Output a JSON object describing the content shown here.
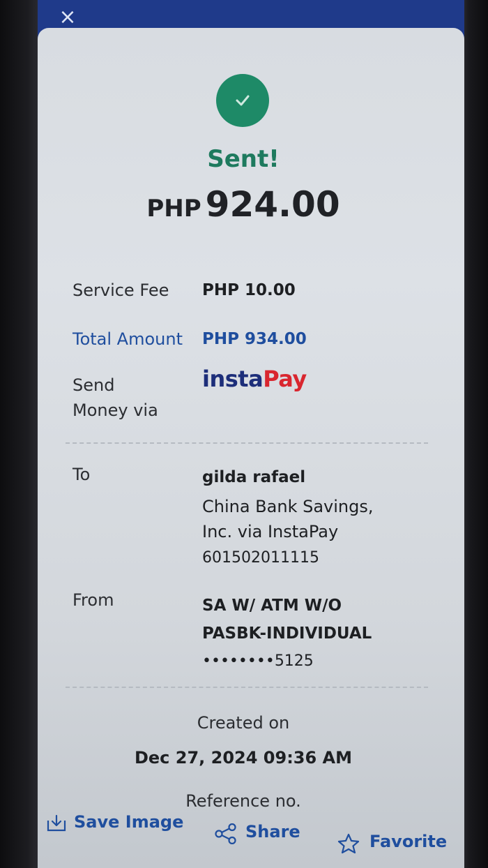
{
  "header": {
    "close_label": "×"
  },
  "status": {
    "title": "Sent!",
    "currency": "PHP",
    "amount": "924.00"
  },
  "details": {
    "service_fee_label": "Service Fee",
    "service_fee_value": "PHP 10.00",
    "total_label": "Total Amount",
    "total_value": "PHP 934.00",
    "via_label_line1": "Send",
    "via_label_line2": "Money via",
    "via_logo_part1": "insta",
    "via_logo_part2": "Pay",
    "to_label": "To",
    "to_name": "gilda rafael",
    "to_bank_line1": "China Bank Savings,",
    "to_bank_line2": "Inc. via InstaPay",
    "to_account": "601502011115",
    "from_label": "From",
    "from_account_type_line1": "SA W/ ATM W/O",
    "from_account_type_line2": "PASBK-INDIVIDUAL",
    "from_account_masked": "••••••••5125"
  },
  "meta": {
    "created_label": "Created on",
    "created_value": "Dec 27, 2024 09:36 AM",
    "reference_label": "Reference no."
  },
  "actions": {
    "save_label": "Save Image",
    "share_label": "Share",
    "favorite_label": "Favorite"
  },
  "colors": {
    "header_blue": "#1f3a8a",
    "success_green": "#1e8a67",
    "link_blue": "#1f4e9e",
    "instapay_red": "#d9262f"
  }
}
